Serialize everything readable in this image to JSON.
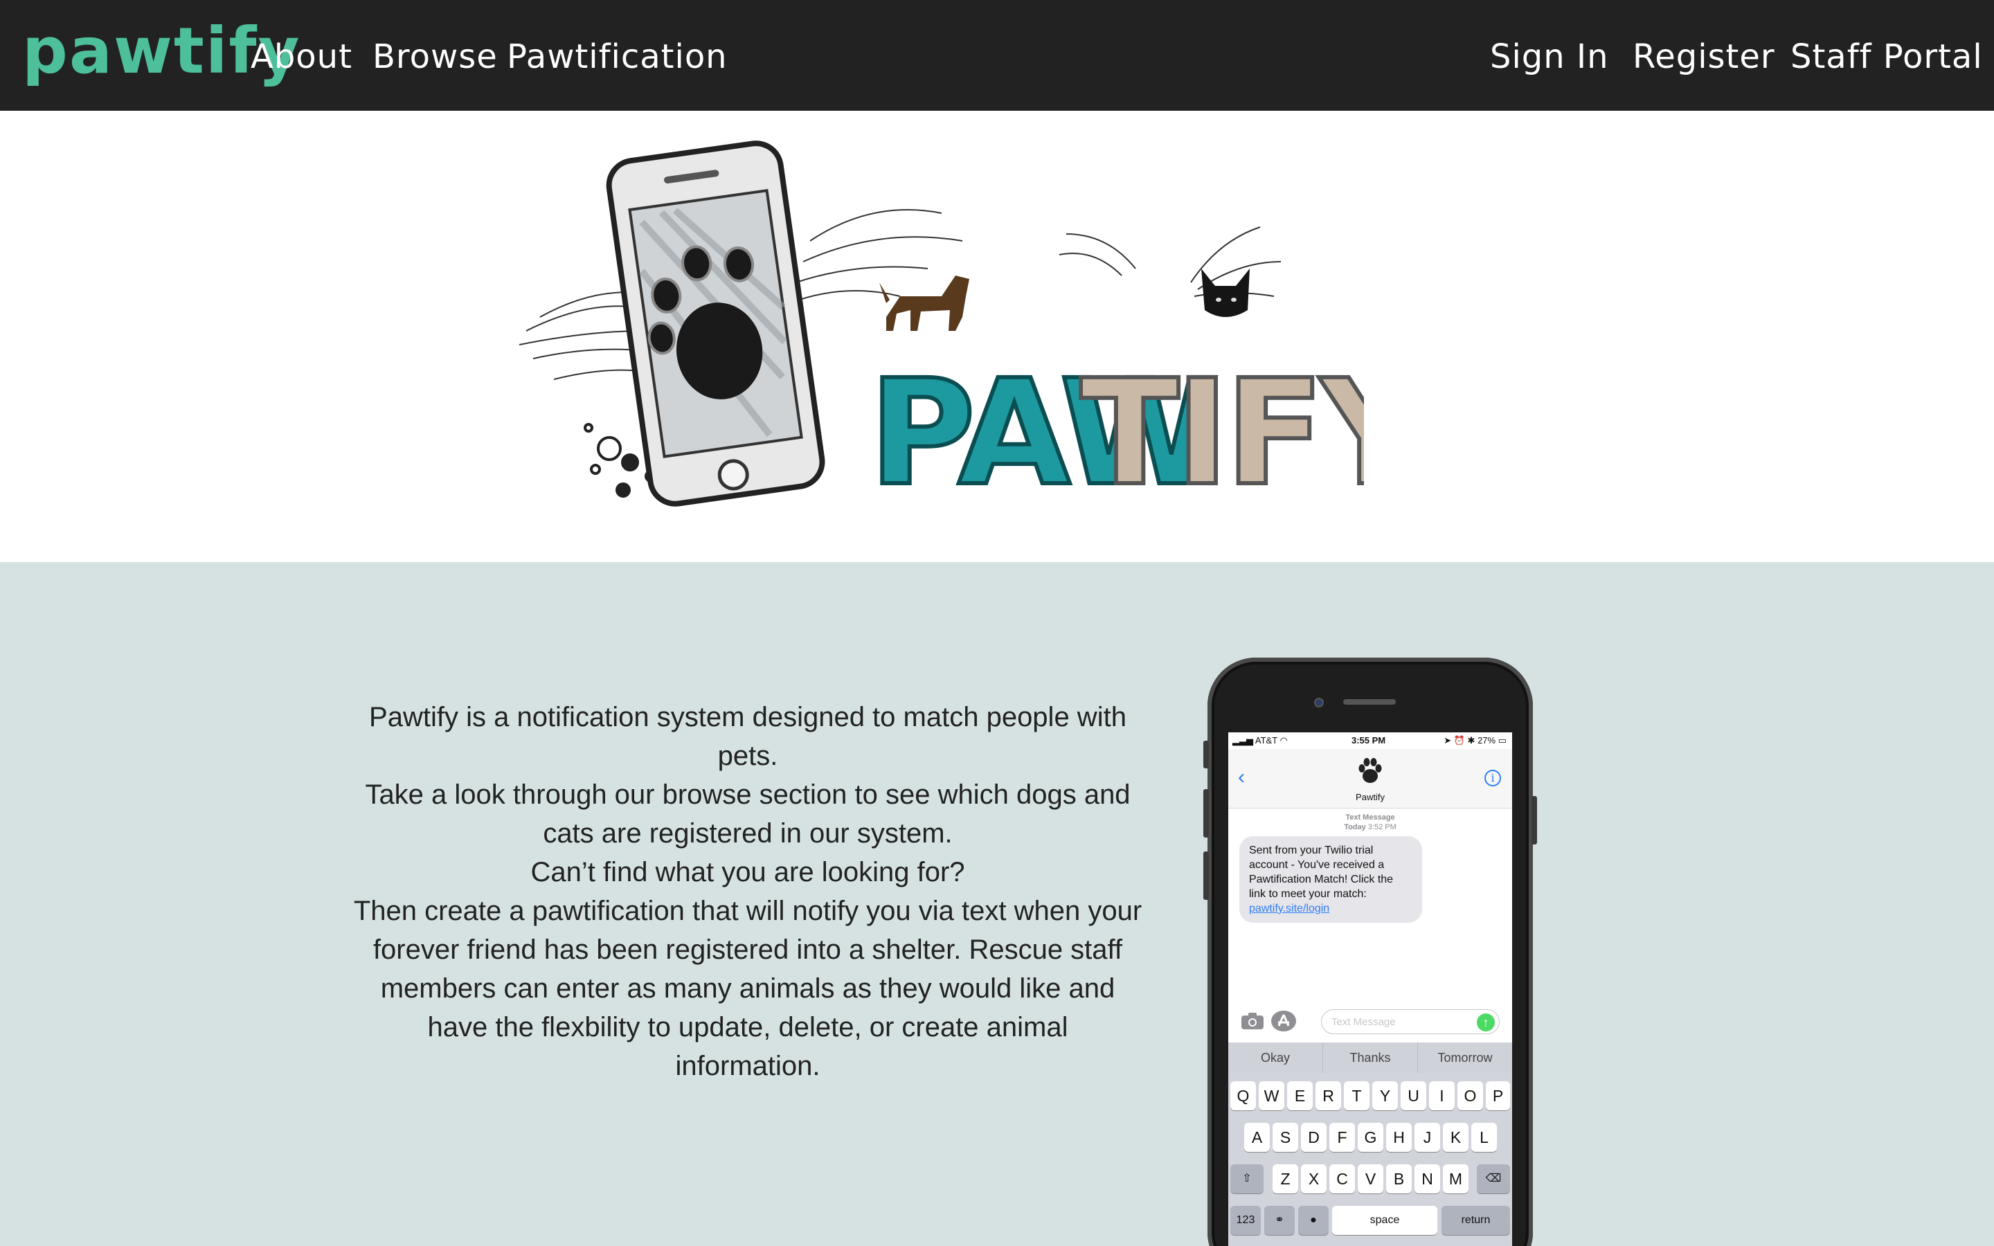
{
  "navbar": {
    "brand": "pawtify",
    "links_left": [
      "About",
      "Browse",
      "Pawtification"
    ],
    "links_right": [
      "Sign In",
      "Register",
      "Staff Portal"
    ],
    "brand_color": "#4dbf9b",
    "background": "#222222"
  },
  "hero": {
    "logo_text_teal": "PAW",
    "logo_text_tan": "TIFY",
    "colors": {
      "teal": "#1d9aa0",
      "tan": "#c9b9a6"
    }
  },
  "info": {
    "background": "#d6e2e2",
    "paragraphs": [
      "Pawtify is a notification system designed to match people with pets.",
      "Take a look through our browse section to see which dogs and cats are registered in our system.",
      "Can’t find what you are looking for?",
      "Then create a pawtification that will notify you via text when your forever friend has been registered into a shelter. Rescue staff members can enter as many animals as they would like and have the flexbility to update, delete, or create animal information."
    ]
  },
  "phone": {
    "status": {
      "carrier": "AT&T",
      "time": "3:55 PM",
      "battery": "27%"
    },
    "contact_name": "Pawtify",
    "meta_label": "Text Message",
    "meta_day": "Today",
    "meta_time": "3:52 PM",
    "message_text": "Sent from your Twilio trial account - You've received a Pawtification Match! Click the link to meet your match: ",
    "message_link": "pawtify.site/login",
    "input_placeholder": "Text Message",
    "suggestions": [
      "Okay",
      "Thanks",
      "Tomorrow"
    ],
    "keyboard": {
      "row1": [
        "Q",
        "W",
        "E",
        "R",
        "T",
        "Y",
        "U",
        "I",
        "O",
        "P"
      ],
      "row2": [
        "A",
        "S",
        "D",
        "F",
        "G",
        "H",
        "J",
        "K",
        "L"
      ],
      "row3": [
        "Z",
        "X",
        "C",
        "V",
        "B",
        "N",
        "M"
      ],
      "num_key": "123",
      "space_key": "space",
      "return_key": "return"
    }
  }
}
